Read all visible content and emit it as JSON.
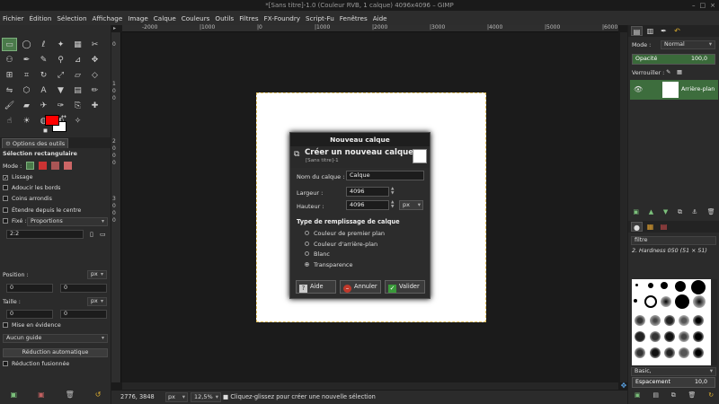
{
  "window": {
    "title": "*[Sans titre]-1.0 (Couleur RVB, 1 calque) 4096x4096 – GIMP"
  },
  "menubar": [
    "Fichier",
    "Édition",
    "Sélection",
    "Affichage",
    "Image",
    "Calque",
    "Couleurs",
    "Outils",
    "Filtres",
    "FX-Foundry",
    "Script-Fu",
    "Fenêtres",
    "Aide"
  ],
  "tool_options": {
    "tab_label": "Options des outils",
    "tool_name": "Sélection rectangulaire",
    "mode_label": "Mode :",
    "antialias_label": "Lissage",
    "feather_label": "Adoucir les bords",
    "rounded_label": "Coins arrondis",
    "expand_label": "Étendre depuis le centre",
    "fixed_label": "Fixé :",
    "fixed_value": "Proportions",
    "ratio_value": "2:2",
    "position_label": "Position :",
    "position_unit": "px",
    "position_x": "0",
    "position_y": "0",
    "size_label": "Taille :",
    "size_unit": "px",
    "size_w": "0",
    "size_h": "0",
    "highlight_label": "Mise en évidence",
    "guide_value": "Aucun guide",
    "autoshrink_label": "Réduction automatique",
    "merged_label": "Réduction fusionnée"
  },
  "rulers": {
    "h_ticks": [
      "-2000",
      "|1000",
      "|0",
      "|1000",
      "|2000",
      "|3000",
      "|4000",
      "|5000",
      "|6000"
    ],
    "v_ticks": [
      "0",
      "1",
      "0",
      "0",
      "2",
      "0",
      "0",
      "0",
      "3",
      "0",
      "0",
      "0"
    ]
  },
  "dialog": {
    "title": "Nouveau calque",
    "heading": "Créer un nouveau calque",
    "subheading": "[Sans titre]-1",
    "name_label": "Nom du calque :",
    "name_value": "Calque",
    "width_label": "Largeur :",
    "width_value": "4096",
    "height_label": "Hauteur :",
    "height_value": "4096",
    "unit_value": "px",
    "fill_title": "Type de remplissage de calque",
    "fill_options": [
      "Couleur de premier plan",
      "Couleur d'arrière-plan",
      "Blanc",
      "Transparence"
    ],
    "selected_fill": "Transparence",
    "help_label": "Aide",
    "cancel_label": "Annuler",
    "ok_label": "Valider"
  },
  "statusbar": {
    "coords": "2776, 3848",
    "unit": "px",
    "zoom": "12,5%",
    "message": "Cliquez-glissez pour créer une nouvelle sélection"
  },
  "layers": {
    "mode_label": "Mode :",
    "mode_value": "Normal",
    "opacity_label": "Opacité",
    "opacity_value": "100,0",
    "lock_label": "Verrouiller :",
    "layer_name": "Arrière-plan"
  },
  "brushes": {
    "filter_value": "filtre",
    "brush_name": "2. Hardness 050 (51 × 51)",
    "category_value": "Basic,",
    "spacing_label": "Espacement",
    "spacing_value": "10,0"
  },
  "colors": {
    "foreground": "#ff0000",
    "background": "#ffffff",
    "accent": "#3d6d3d"
  }
}
